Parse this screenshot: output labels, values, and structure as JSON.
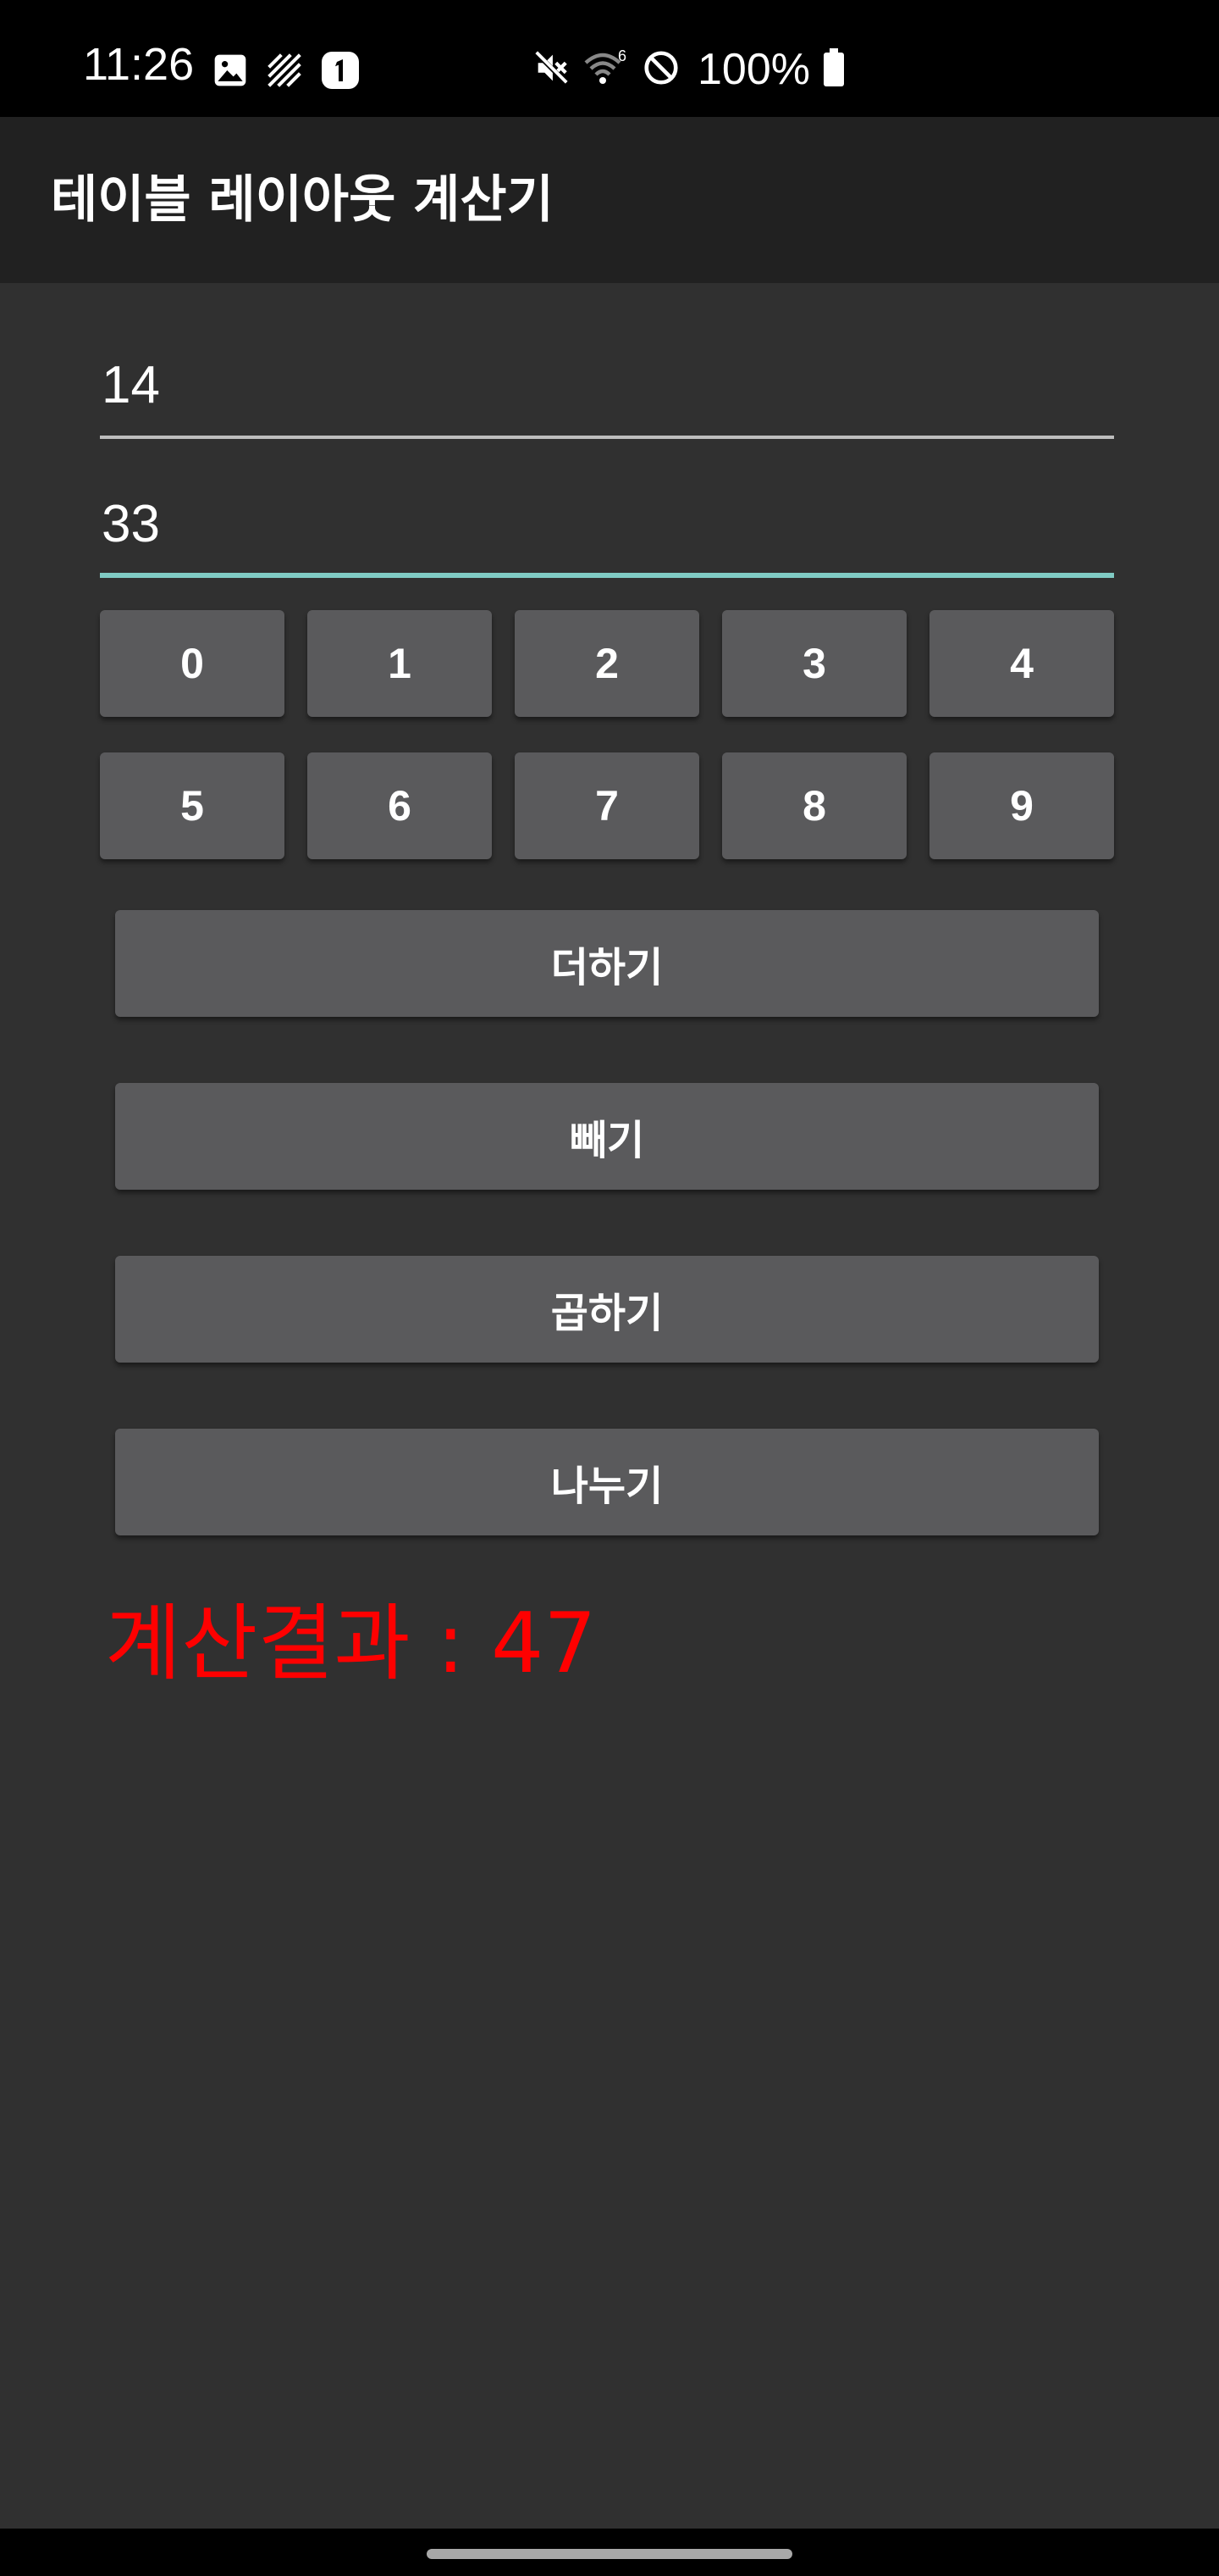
{
  "status_bar": {
    "time": "11:26",
    "notification_icons": [
      "image-icon",
      "no-signal-stripes-icon",
      "sim-1-icon"
    ],
    "system_icons": [
      "mute-icon",
      "wifi-6-icon",
      "do-not-disturb-icon"
    ],
    "battery": "100%",
    "battery_icon": "battery-full-icon"
  },
  "app_bar": {
    "title": "테이블 레이아웃 계산기"
  },
  "inputs": {
    "num1": "14",
    "num2": "33",
    "num2_focused": true,
    "focus_color": "#80cbc4"
  },
  "digits": [
    "0",
    "1",
    "2",
    "3",
    "4",
    "5",
    "6",
    "7",
    "8",
    "9"
  ],
  "operations": {
    "add": "더하기",
    "subtract": "빼기",
    "multiply": "곱하기",
    "divide": "나누기"
  },
  "result": {
    "text": "계산결과 : 47",
    "color": "#ff0000"
  },
  "colors": {
    "background": "#303030",
    "app_bar": "#212121",
    "button": "#5a5a5c"
  }
}
